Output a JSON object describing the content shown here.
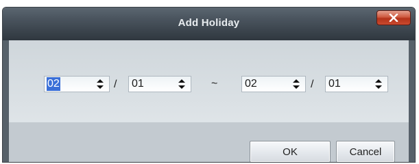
{
  "dialog": {
    "title": "Add Holiday",
    "close_label": "x"
  },
  "date_range": {
    "start_month": "02",
    "start_day": "01",
    "range_separator": "~",
    "date_separator": "/",
    "end_month": "02",
    "end_day": "01"
  },
  "buttons": {
    "ok": "OK",
    "cancel": "Cancel"
  },
  "colors": {
    "titlebar": "#2f373f",
    "close_button": "#c94a2f",
    "selection": "#3a6fd8"
  }
}
